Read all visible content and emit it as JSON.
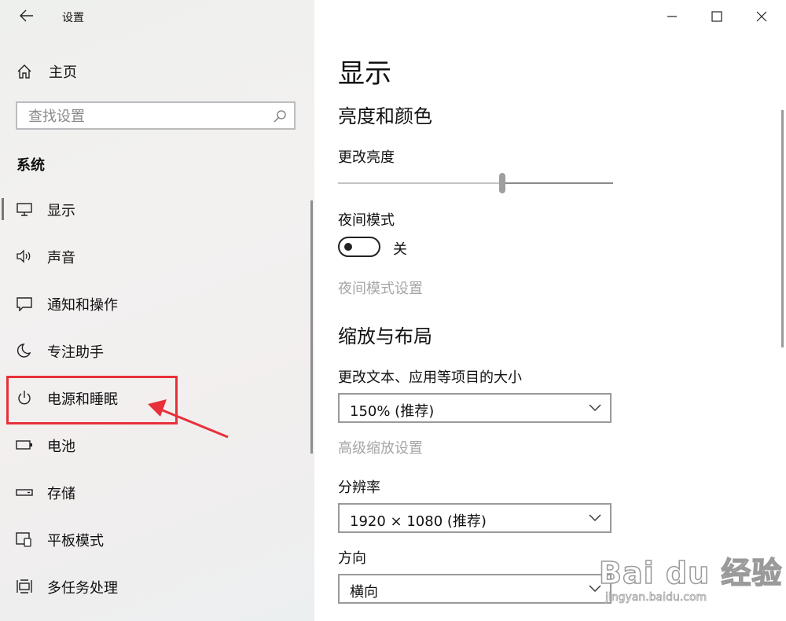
{
  "app": {
    "title": "设置"
  },
  "nav": {
    "home_label": "主页",
    "search_placeholder": "查找设置",
    "section_label": "系统",
    "items": [
      {
        "label": "显示",
        "icon": "monitor-icon"
      },
      {
        "label": "声音",
        "icon": "speaker-icon"
      },
      {
        "label": "通知和操作",
        "icon": "notification-icon"
      },
      {
        "label": "专注助手",
        "icon": "moon-icon"
      },
      {
        "label": "电源和睡眠",
        "icon": "power-icon"
      },
      {
        "label": "电池",
        "icon": "battery-icon"
      },
      {
        "label": "存储",
        "icon": "storage-icon"
      },
      {
        "label": "平板模式",
        "icon": "tablet-mode-icon"
      },
      {
        "label": "多任务处理",
        "icon": "multitasking-icon"
      }
    ],
    "active_item": "显示",
    "highlighted_item": "电源和睡眠"
  },
  "main": {
    "page_title": "显示",
    "brightness_section": {
      "title": "亮度和颜色",
      "brightness_label": "更改亮度",
      "brightness_value": 0.6,
      "night_mode_label": "夜间模式",
      "night_mode_state": "关",
      "night_mode_settings_link": "夜间模式设置"
    },
    "layout_section": {
      "title": "缩放与布局",
      "scale_label": "更改文本、应用等项目的大小",
      "scale_value": "150% (推荐)",
      "advanced_scale_link": "高级缩放设置",
      "resolution_label": "分辨率",
      "resolution_value": "1920 × 1080 (推荐)",
      "orientation_label": "方向",
      "orientation_value": "横向"
    }
  },
  "colors": {
    "highlight": "#e8303a",
    "accent_gray": "#9e9e9e"
  },
  "watermark": {
    "logo": "Bai du 经验",
    "url": "jingyan.baidu.com"
  }
}
